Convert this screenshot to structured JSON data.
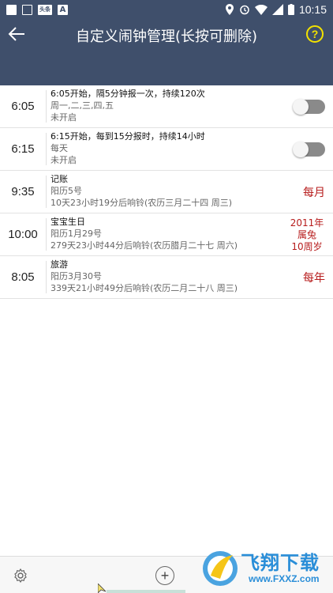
{
  "status_bar": {
    "time": "10:15",
    "badge_text": "头条",
    "letter_icon": "A",
    "icons": [
      "square-icon",
      "shield-icon",
      "toutiao-badge-icon",
      "a-letter-icon",
      "location-icon",
      "alarm-icon",
      "wifi-icon",
      "signal-icon",
      "battery-icon"
    ]
  },
  "app_bar": {
    "title": "自定义闹钟管理(长按可删除)",
    "help_label": "?"
  },
  "alarms": [
    {
      "time": "6:05",
      "line1": "6:05开始，隔5分钟报一次，持续120次",
      "line2": "周一,二,三,四,五",
      "line3": "未开启",
      "right_type": "toggle",
      "enabled": false
    },
    {
      "time": "6:15",
      "line1": "6:15开始，每到15分报时，持续14小时",
      "line2": "每天",
      "line3": "未开启",
      "right_type": "toggle",
      "enabled": false
    },
    {
      "time": "9:35",
      "line1": "记账",
      "line2": "阳历5号",
      "line3": "10天23小时19分后响铃(农历三月二十四 周三)",
      "right_type": "tag",
      "tag": "每月"
    },
    {
      "time": "10:00",
      "line1": "宝宝生日",
      "line2": "阳历1月29号",
      "line3": "279天23小时44分后响铃(农历腊月二十七 周六)",
      "right_type": "tag-multi",
      "tag_lines": [
        "2011年",
        "属兔",
        "10周岁"
      ]
    },
    {
      "time": "8:05",
      "line1": "旅游",
      "line2": "阳历3月30号",
      "line3": "339天21小时49分后响铃(农历二月二十八 周三)",
      "right_type": "tag",
      "tag": "每年"
    }
  ],
  "bottom_bar": {
    "add_label": "+"
  },
  "watermark": {
    "text": "飞翔下载",
    "sub": "www.FXXZ.com"
  },
  "colors": {
    "header": "#3f4f6b",
    "accent_yellow": "#f3e200",
    "tag_red": "#b71c1c"
  }
}
